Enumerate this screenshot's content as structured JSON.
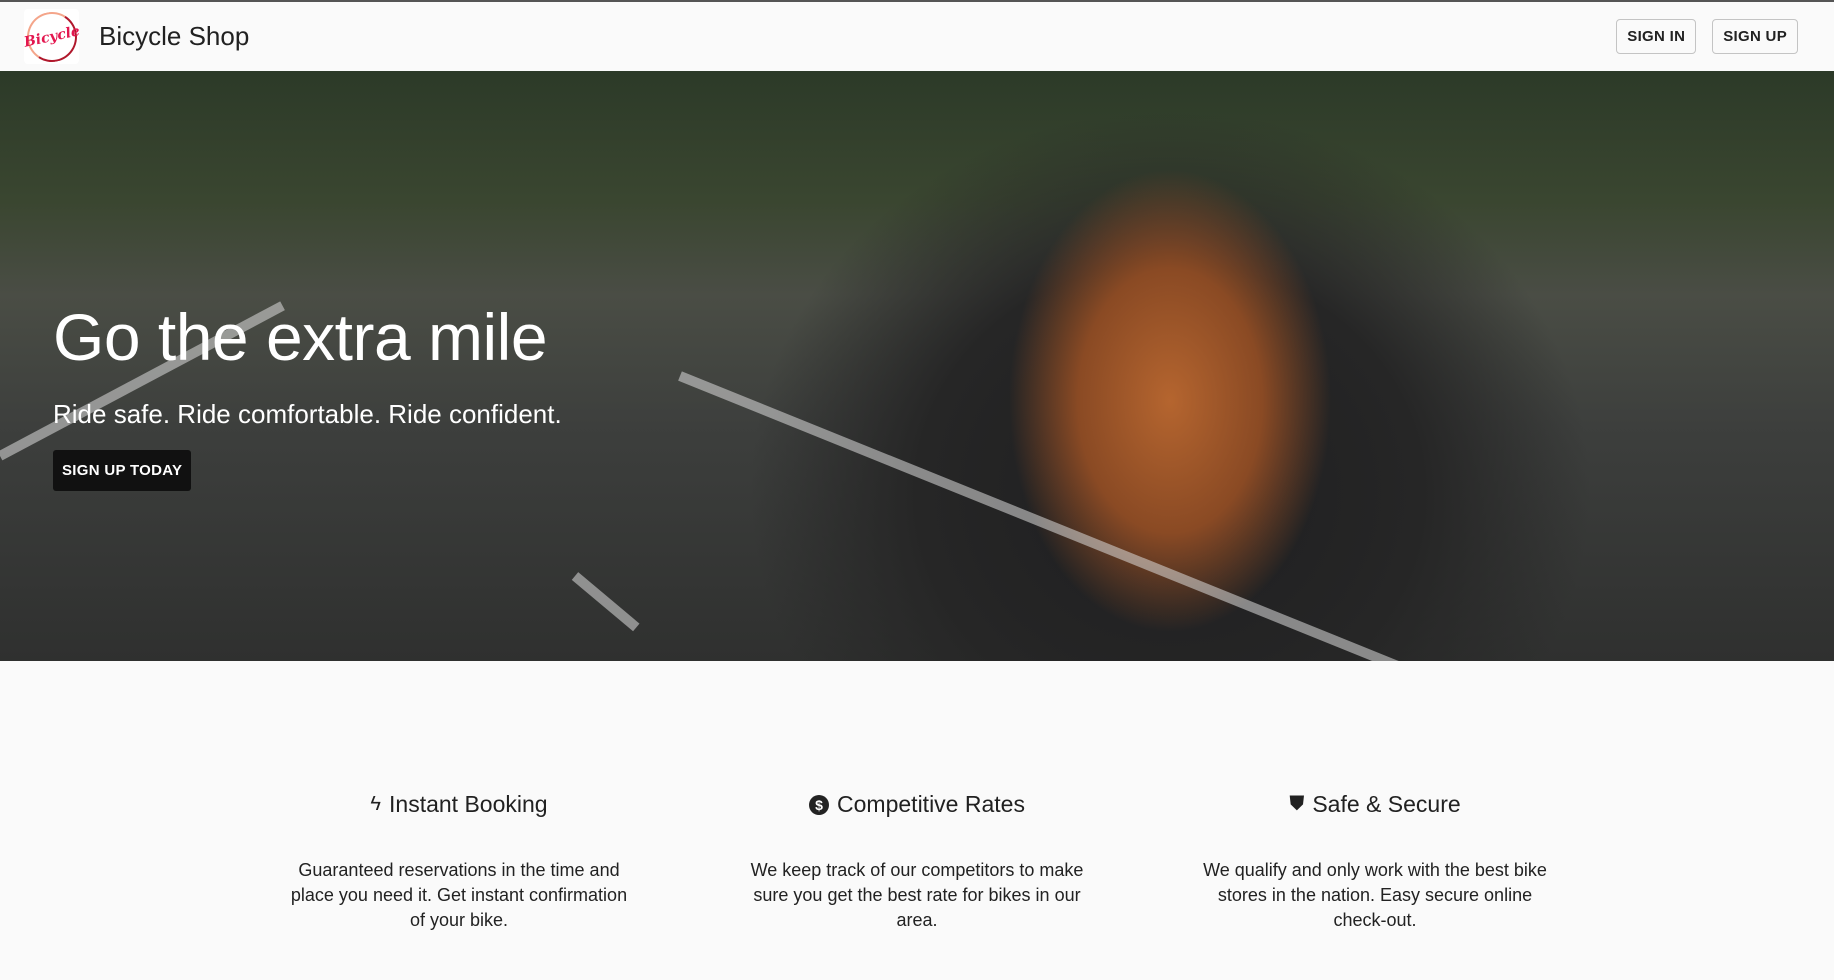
{
  "header": {
    "logo_text": "Bicycle",
    "title": "Bicycle Shop",
    "sign_in": "SIGN IN",
    "sign_up": "SIGN UP"
  },
  "hero": {
    "title": "Go the extra mile",
    "subtitle": "Ride safe. Ride comfortable. Ride confident.",
    "cta": "SIGN UP TODAY"
  },
  "features": [
    {
      "icon": "lightning-icon",
      "glyph": "ϟ",
      "title": "Instant Booking",
      "text": "Guaranteed reservations in the time and place you need it. Get instant confirmation of your bike."
    },
    {
      "icon": "dollar-circle-icon",
      "glyph": "$",
      "title": "Competitive Rates",
      "text": "We keep track of our competitors to make sure you get the best rate for bikes in our area."
    },
    {
      "icon": "shield-icon",
      "glyph": "⛊",
      "title": "Safe & Secure",
      "text": "We qualify and only work with the best bike stores in the nation. Easy secure online check-out."
    }
  ]
}
